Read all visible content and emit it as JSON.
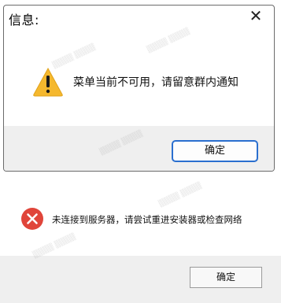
{
  "dialog_warning": {
    "title": "信息:",
    "close_glyph": "✕",
    "message": "菜单当前不可用，请留意群内通知",
    "icon": "warning-icon",
    "ok_label": "确定",
    "colors": {
      "warning_fill": "#f5b82e",
      "ok_border": "#2a6fcf",
      "footer_bg": "#efefef"
    }
  },
  "dialog_error": {
    "message": "未连接到服务器，请尝试重进安装器或检查网络",
    "icon": "error-icon",
    "ok_label": "确定",
    "colors": {
      "error_fill": "#e0453a",
      "footer_bg": "#efefef"
    }
  }
}
